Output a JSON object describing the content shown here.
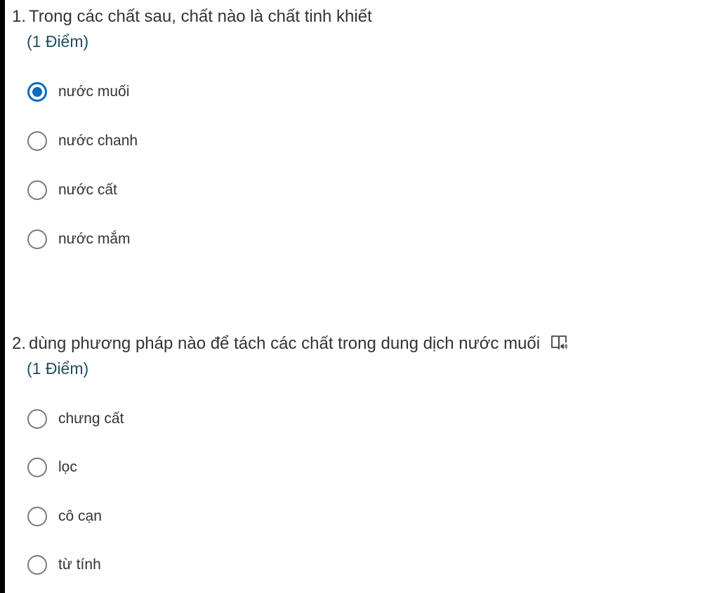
{
  "questions": [
    {
      "number": "1.",
      "title": "Trong các chất sau, chất nào là chất tinh khiết",
      "points": "(1 Điểm)",
      "options": [
        {
          "label": "nước muối",
          "selected": true
        },
        {
          "label": "nước chanh",
          "selected": false
        },
        {
          "label": "nước cất",
          "selected": false
        },
        {
          "label": "nước mắm",
          "selected": false
        }
      ]
    },
    {
      "number": "2.",
      "title": "dùng phương pháp nào để tách các chất trong dung dịch nước muối",
      "points": "(1 Điểm)",
      "icon": "immersive-reader-icon",
      "options": [
        {
          "label": "chưng cất",
          "selected": false
        },
        {
          "label": "lọc",
          "selected": false
        },
        {
          "label": "cô cạn",
          "selected": false
        },
        {
          "label": "từ tính",
          "selected": false
        }
      ]
    }
  ],
  "colors": {
    "accent": "#0f6cbd",
    "points_text": "#1f4e5f",
    "body_text": "#333333",
    "radio_border": "#7a7a7a"
  }
}
